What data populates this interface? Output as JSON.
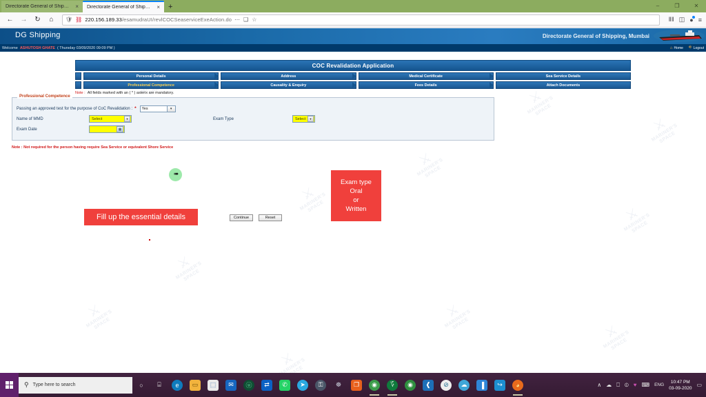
{
  "browser": {
    "tabs": [
      {
        "title": "Directorate General of Shipping : G",
        "close": "×",
        "active": false
      },
      {
        "title": "Directorate General of Shipping",
        "close": "×",
        "active": true
      }
    ],
    "new_tab_label": "+",
    "window_controls": {
      "minimize": "–",
      "maximize": "❐",
      "close": "✕"
    },
    "nav": {
      "back": "←",
      "forward": "→",
      "reload": "↻",
      "home": "⌂"
    },
    "url": {
      "host": "220.156.189.33",
      "path": "/esamudraUI/revlCOCSeaserviceExeAction.do",
      "shield_icon": "shield-icon",
      "insecure_icon": "broken-lock-icon"
    },
    "url_actions": {
      "more": "⋯",
      "reader": "❑",
      "bookmark": "☆"
    },
    "toolbar_actions": {
      "library": "Ⅱ‖",
      "sidebar": "◫",
      "account": "●",
      "menu": "≡"
    }
  },
  "site": {
    "brand": "DG Shipping",
    "org": "Directorate General of Shipping, Mumbai",
    "ship_icon": "ship-icon",
    "welcome_prefix": "Welcome",
    "user_name": "ASHUTOSH GHATE",
    "session_time": "( Thursday 03/09/2020 09:09 PM )",
    "links": [
      {
        "label": "Home",
        "icon": "home-icon"
      },
      {
        "label": "Logout",
        "icon": "logout-icon"
      }
    ],
    "watermark_text": "MARINER'S SPACE"
  },
  "form": {
    "page_title": "COC Revalidation Application",
    "tab_rows": [
      [
        {
          "label": "Personal Details",
          "selected": false
        },
        {
          "label": "Address",
          "selected": false
        },
        {
          "label": "Medical Certificate",
          "selected": false
        },
        {
          "label": "Sea Service Details",
          "selected": false
        }
      ],
      [
        {
          "label": "Professional Competence",
          "selected": true
        },
        {
          "label": "Causality & Enquiry",
          "selected": false
        },
        {
          "label": "Fees Details",
          "selected": false
        },
        {
          "label": "Attach Documents",
          "selected": false
        }
      ]
    ],
    "note_key": "Note :",
    "note_value": "All fields marked with an ( * ) asterix are mandatory.",
    "legend": "Professional Competence",
    "fields": {
      "passing_test_label": "Passing an approved test for the purpose of CoC Revalidation :",
      "passing_test_required": "*",
      "passing_test_value": "Yes",
      "mmd_label": "Name of MMD",
      "mmd_value": "Select",
      "exam_type_label": "Exam Type",
      "exam_type_value": "Select",
      "exam_date_label": "Exam Date",
      "exam_date_value": "",
      "calendar_icon": "calendar-icon",
      "dropdown_arrow": "▾"
    },
    "note2": "Note : Not required for the person having require Sea Service or equivalent Shore Service",
    "buttons": {
      "continue": "Continue",
      "reset": "Reset"
    },
    "callouts": {
      "fill_details": "Fill up the essential details",
      "exam_type_line1": "Exam type",
      "exam_type_line2": "Oral",
      "exam_type_line3": "or",
      "exam_type_line4": "Written"
    },
    "colors": {
      "header_blue": "#1a5f9e",
      "tab_selected_text": "#ffd24d",
      "required_red": "#cc0000",
      "highlight_yellow": "#ffff00",
      "callout_red": "#f0403c"
    }
  },
  "taskbar": {
    "start_icon": "windows-start-icon",
    "search_placeholder": "Type here to search",
    "search_icon": "search-icon",
    "pinned": [
      {
        "name": "cortana-icon",
        "glyph": "○",
        "color": "transparent",
        "text": "#e8e8e8",
        "running": false
      },
      {
        "name": "task-view-icon",
        "glyph": "⌸",
        "color": "transparent",
        "text": "#e8e8e8",
        "running": false
      },
      {
        "name": "edge-icon",
        "glyph": "e",
        "color": "#0f7bbd",
        "text": "#ffffff",
        "running": false
      },
      {
        "name": "file-explorer-icon",
        "glyph": "▭",
        "color": "#f2b33d",
        "text": "#6a4a00",
        "running": false
      },
      {
        "name": "microsoft-store-icon",
        "glyph": "⬚",
        "color": "#eaeaea",
        "text": "#1c5fa8",
        "running": false
      },
      {
        "name": "mail-icon",
        "glyph": "✉",
        "color": "#1666c0",
        "text": "#ffffff",
        "running": false
      },
      {
        "name": "utorrent-icon",
        "glyph": "ⓤ",
        "color": "#0f4d33",
        "text": "#6ee6a8",
        "running": false
      },
      {
        "name": "teamviewer-icon",
        "glyph": "⇄",
        "color": "#0b61c4",
        "text": "#ffffff",
        "running": false
      },
      {
        "name": "whatsapp-icon",
        "glyph": "✆",
        "color": "#25d366",
        "text": "#ffffff",
        "running": false
      },
      {
        "name": "telegram-icon",
        "glyph": "➤",
        "color": "#2aa8e0",
        "text": "#ffffff",
        "running": false
      },
      {
        "name": "lock-app-icon",
        "glyph": "⚿",
        "color": "#4a5668",
        "text": "#ffffff",
        "running": false
      },
      {
        "name": "network-app-icon",
        "glyph": "☸",
        "color": "transparent",
        "text": "#cfd4e2",
        "running": false
      },
      {
        "name": "photos-icon",
        "glyph": "❐",
        "color": "#e8601c",
        "text": "#ffffff",
        "running": false
      },
      {
        "name": "chrome-icon",
        "glyph": "◉",
        "color": "#3b9c4a",
        "text": "#ffffff",
        "running": true
      },
      {
        "name": "jio-icon",
        "glyph": "؆",
        "color": "#0f7a3c",
        "text": "#ffffff",
        "running": true
      },
      {
        "name": "chrome-canary-icon",
        "glyph": "◉",
        "color": "#2f8f3f",
        "text": "#ffffff",
        "running": false
      },
      {
        "name": "vscode-icon",
        "glyph": "❰",
        "color": "#1d6fb8",
        "text": "#ffffff",
        "running": false
      },
      {
        "name": "adblock-icon",
        "glyph": "⊘",
        "color": "#eeeeee",
        "text": "#1a6b8e",
        "running": false
      },
      {
        "name": "cloud-app-icon",
        "glyph": "☁",
        "color": "#3fa6d8",
        "text": "#ffffff",
        "running": false
      },
      {
        "name": "notepad-icon",
        "glyph": "▐",
        "color": "#2f86d8",
        "text": "#ffffff",
        "running": false
      },
      {
        "name": "backup-icon",
        "glyph": "↪",
        "color": "#1d8fd1",
        "text": "#ffffff",
        "running": false
      },
      {
        "name": "firefox-icon",
        "glyph": "◕",
        "color": "#e86a1c",
        "text": "#ffe08a",
        "running": true
      }
    ],
    "tray": {
      "chevron": "∧",
      "onedrive": "☁",
      "display": "⎕",
      "volume": "⦶",
      "heart": "♥",
      "keyboard": "⌨",
      "language": "ENG",
      "time": "10:47 PM",
      "date": "03-09-2020",
      "action_center": "▭"
    }
  }
}
